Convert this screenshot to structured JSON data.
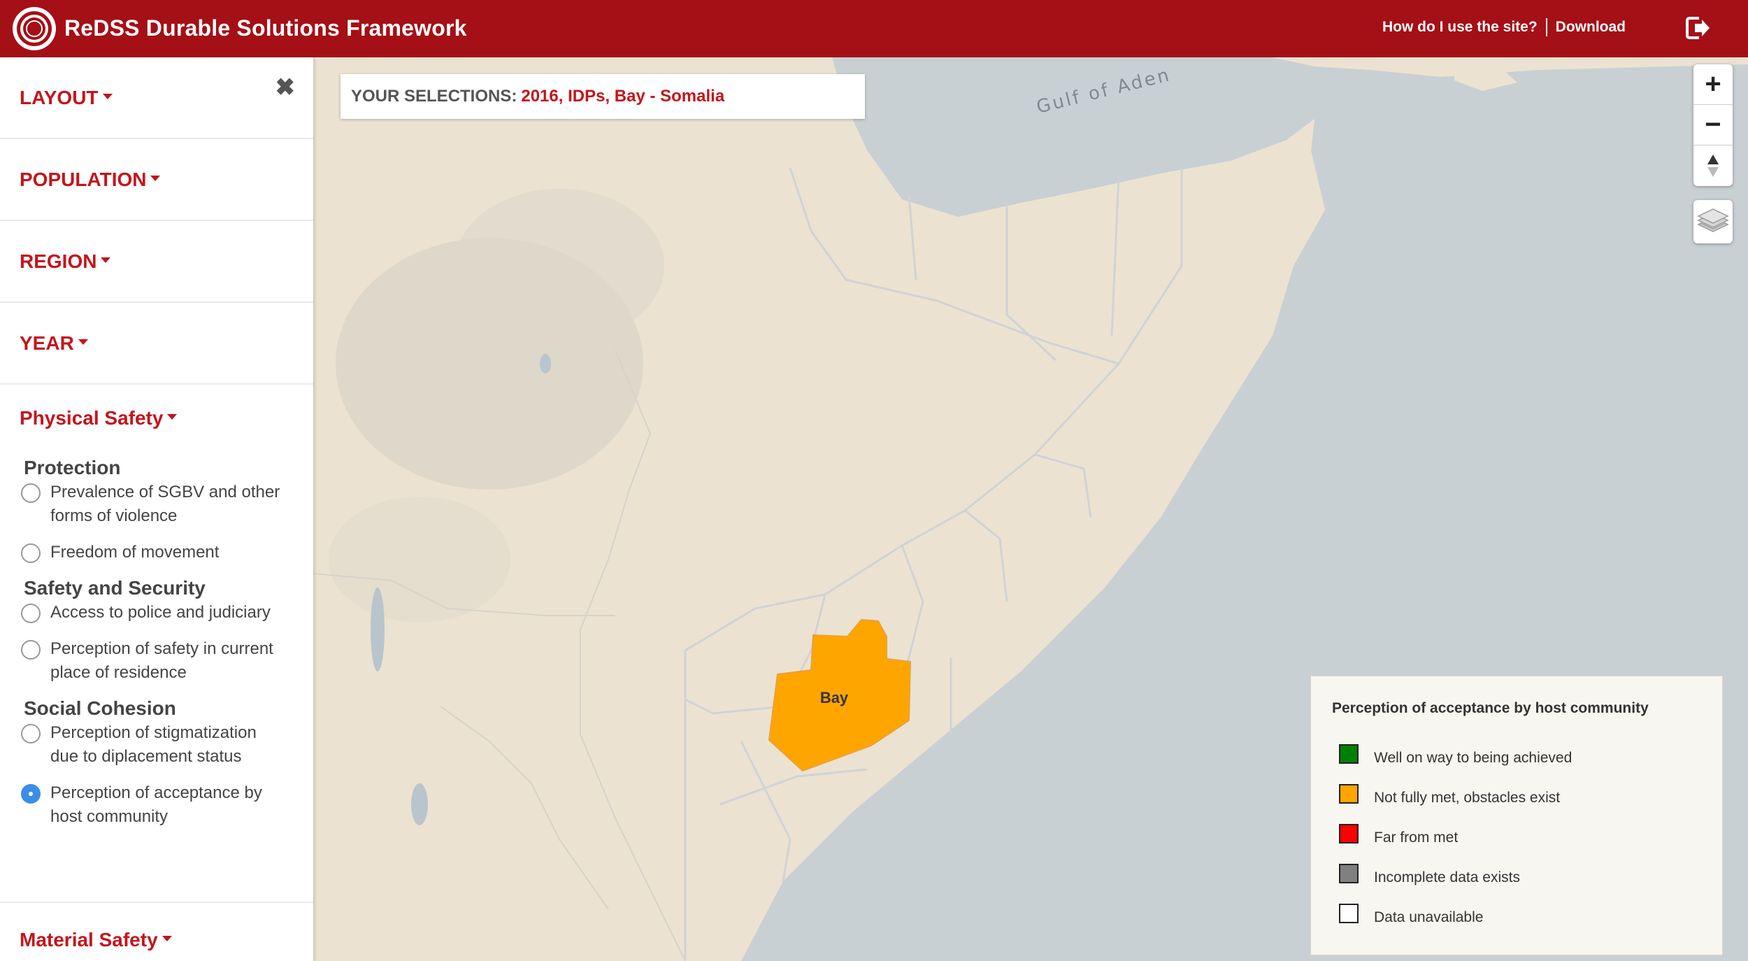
{
  "header": {
    "title": "ReDSS Durable Solutions Framework",
    "nav_help": "How do I use the site?",
    "nav_download": "Download"
  },
  "sidebar": {
    "sections": [
      {
        "label": "LAYOUT"
      },
      {
        "label": "POPULATION"
      },
      {
        "label": "REGION"
      },
      {
        "label": "YEAR"
      }
    ],
    "physical_safety": {
      "label": "Physical Safety",
      "groups": [
        {
          "title": "Protection",
          "options": [
            {
              "label": "Prevalence of SGBV and other forms of violence",
              "checked": false
            },
            {
              "label": "Freedom of movement",
              "checked": false
            }
          ]
        },
        {
          "title": "Safety and Security",
          "options": [
            {
              "label": "Access to police and judiciary",
              "checked": false
            },
            {
              "label": "Perception of safety in current place of residence",
              "checked": false
            }
          ]
        },
        {
          "title": "Social Cohesion",
          "options": [
            {
              "label": "Perception of stigmatization due to diplacement status",
              "checked": false
            },
            {
              "label": "Perception of acceptance by host community",
              "checked": true
            }
          ]
        }
      ]
    },
    "material_safety": {
      "label": "Material Safety"
    }
  },
  "selections": {
    "label": "YOUR SELECTIONS:",
    "value": "2016, IDPs, Bay - Somalia"
  },
  "map": {
    "sea_label": "Gulf of Aden",
    "region_label": "Bay",
    "region_color": "#ffa500",
    "land_color": "#ece2d1",
    "water_color": "#c9d0d3"
  },
  "zoom": {
    "in": "+",
    "out": "−",
    "reset": "▲"
  },
  "legend": {
    "title": "Perception of acceptance by host community",
    "items": [
      {
        "label": "Well on way to being achieved",
        "color": "#008000"
      },
      {
        "label": "Not fully met, obstacles exist",
        "color": "#ffa500"
      },
      {
        "label": "Far from met",
        "color": "#ff0000"
      },
      {
        "label": "Incomplete data exists",
        "color": "#808080"
      },
      {
        "label": "Data unavailable",
        "color": "#ffffff"
      }
    ]
  },
  "colors": {
    "brand": "#a50f16",
    "accent": "#c4151c",
    "radio_selected": "#3b8ee8"
  }
}
